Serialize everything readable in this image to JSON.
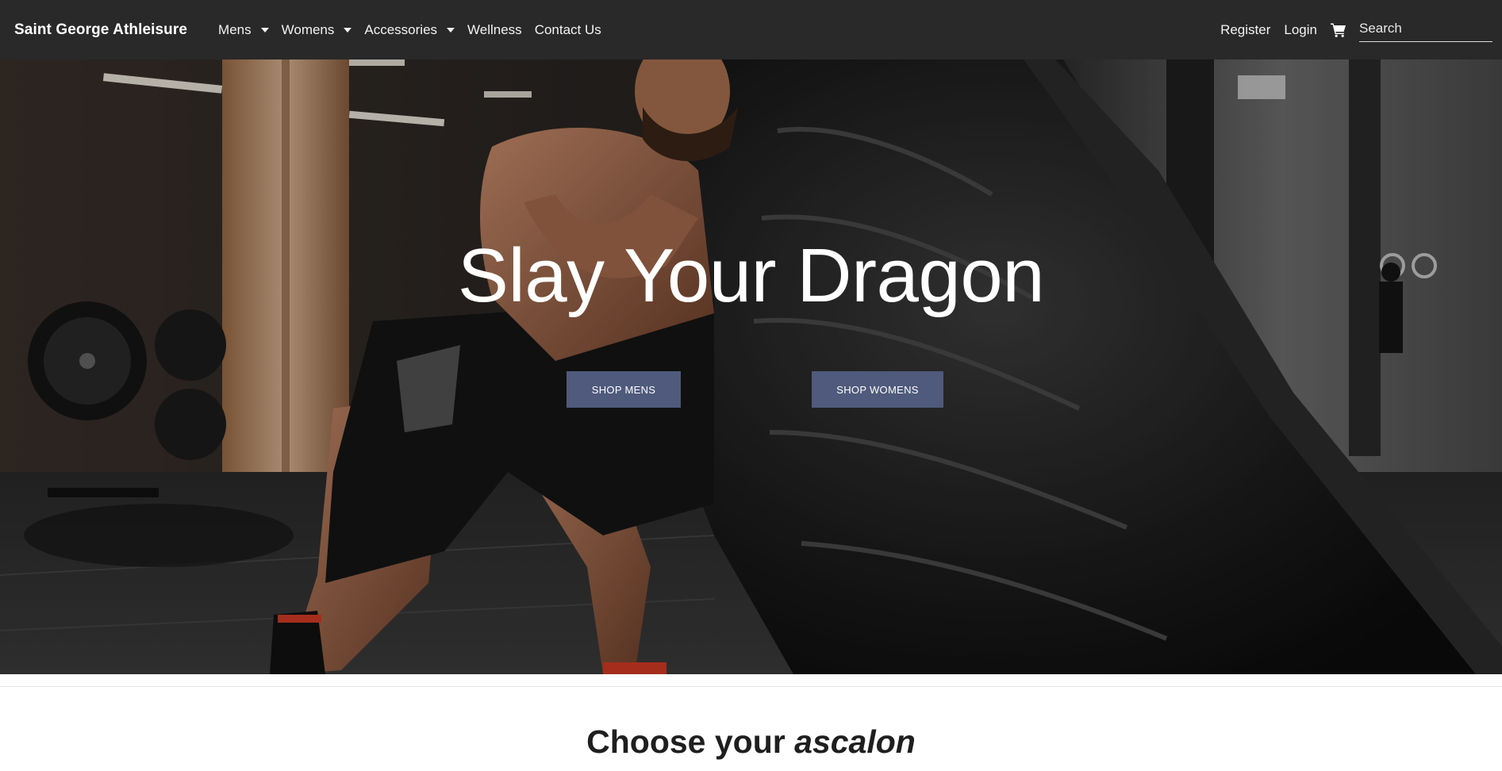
{
  "navbar": {
    "brand": "Saint George Athleisure",
    "menu": [
      {
        "label": "Mens",
        "dropdown": true
      },
      {
        "label": "Womens",
        "dropdown": true
      },
      {
        "label": "Accessories",
        "dropdown": true
      },
      {
        "label": "Wellness",
        "dropdown": false
      },
      {
        "label": "Contact Us",
        "dropdown": false
      }
    ],
    "register_label": "Register",
    "login_label": "Login",
    "cart_icon": "shopping-cart-icon",
    "search_placeholder": "Search"
  },
  "hero": {
    "title": "Slay Your Dragon",
    "shop_mens_label": "SHOP MENS",
    "shop_womens_label": "SHOP WOMENS",
    "button_color": "#4f5a7c"
  },
  "section": {
    "heading_plain": "Choose your",
    "heading_emphasis": "ascalon"
  },
  "colors": {
    "navbar_bg": "#292929",
    "text_light": "#ffffff",
    "heading_dark": "#1f1f1f"
  }
}
